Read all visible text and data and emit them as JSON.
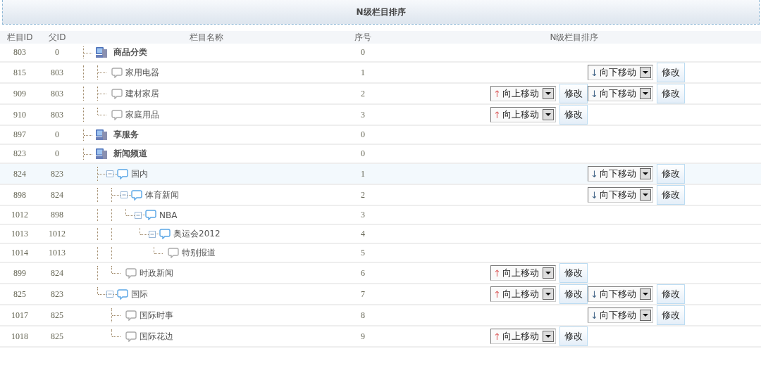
{
  "title": "N级栏目排序",
  "columns": [
    "栏目ID",
    "父ID",
    "栏目名称",
    "序号",
    "N级栏目排序"
  ],
  "rows": [
    {
      "id": "803",
      "parent_id": "0",
      "name": "商品分类",
      "order": "0",
      "selected": false,
      "children": [
        {
          "id": "815",
          "parent_id": "803",
          "name": "家用电器",
          "order": "1",
          "selected": false,
          "down": {
            "arrow": "↓",
            "label": "向下移动",
            "button": "修改"
          }
        },
        {
          "id": "909",
          "parent_id": "803",
          "name": "建材家居",
          "order": "2",
          "selected": false,
          "up": {
            "arrow": "↑",
            "label": "向上移动",
            "button": "修改"
          },
          "down": {
            "arrow": "↓",
            "label": "向下移动",
            "button": "修改"
          }
        },
        {
          "id": "910",
          "parent_id": "803",
          "name": "家庭用品",
          "order": "3",
          "selected": false,
          "up": {
            "arrow": "↑",
            "label": "向上移动",
            "button": "修改"
          }
        }
      ]
    },
    {
      "id": "897",
      "parent_id": "0",
      "name": "享服务",
      "order": "0",
      "selected": false
    },
    {
      "id": "823",
      "parent_id": "0",
      "name": "新闻频道",
      "order": "0",
      "selected": false,
      "children": [
        {
          "id": "824",
          "parent_id": "823",
          "name": "国内",
          "order": "1",
          "selected": true,
          "down": {
            "arrow": "↓",
            "label": "向下移动",
            "button": "修改"
          },
          "children": [
            {
              "id": "898",
              "parent_id": "824",
              "name": "体育新闻",
              "order": "2",
              "selected": false,
              "down": {
                "arrow": "↓",
                "label": "向下移动",
                "button": "修改"
              },
              "children": [
                {
                  "id": "1012",
                  "parent_id": "898",
                  "name": "NBA",
                  "order": "3",
                  "selected": false,
                  "children": [
                    {
                      "id": "1013",
                      "parent_id": "1012",
                      "name": "奥运会2012",
                      "order": "4",
                      "selected": false,
                      "children": [
                        {
                          "id": "1014",
                          "parent_id": "1013",
                          "name": "特别报道",
                          "order": "5",
                          "selected": false
                        }
                      ]
                    }
                  ]
                }
              ]
            },
            {
              "id": "899",
              "parent_id": "824",
              "name": "时政新闻",
              "order": "6",
              "selected": false,
              "up": {
                "arrow": "↑",
                "label": "向上移动",
                "button": "修改"
              }
            }
          ]
        },
        {
          "id": "825",
          "parent_id": "823",
          "name": "国际",
          "order": "7",
          "selected": false,
          "up": {
            "arrow": "↑",
            "label": "向上移动",
            "button": "修改"
          },
          "down": {
            "arrow": "↓",
            "label": "向下移动",
            "button": "修改"
          },
          "children": [
            {
              "id": "1017",
              "parent_id": "825",
              "name": "国际时事",
              "order": "8",
              "selected": false,
              "down": {
                "arrow": "↓",
                "label": "向下移动",
                "button": "修改"
              }
            },
            {
              "id": "1018",
              "parent_id": "825",
              "name": "国际花边",
              "order": "9",
              "selected": false,
              "up": {
                "arrow": "↑",
                "label": "向上移动",
                "button": "修改"
              }
            }
          ]
        }
      ]
    }
  ]
}
